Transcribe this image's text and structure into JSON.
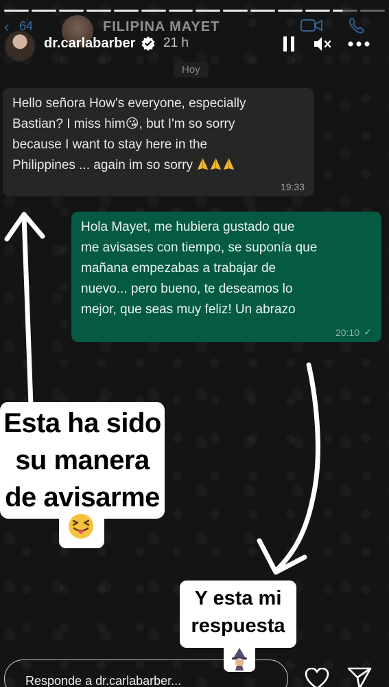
{
  "whatsapp_header": {
    "back_count": "64",
    "contact_name": "FILIPINA MAYET"
  },
  "story_header": {
    "username": "dr.carlabarber",
    "time_ago": "21 h"
  },
  "chat": {
    "day_label": "Hoy",
    "incoming": {
      "line1": "Hello señora How's everyone, especially",
      "line2_a": "Bastian?  I miss him",
      "line2_b": ", but I'm so sorry",
      "line3": "because I want to stay here in the",
      "line4": "Philippines ... again im so sorry",
      "time": "19:33"
    },
    "outgoing": {
      "line1": "Hola Mayet, me hubiera gustado que",
      "line2": "me avisases con tiempo, se suponía que",
      "line3": "mañana empezabas a trabajar de",
      "line4": "nuevo... pero bueno, te deseamos lo",
      "line5": "mejor, que seas muy feliz! Un abrazo",
      "time": "20:10",
      "check": "✓"
    }
  },
  "stickers": {
    "left": {
      "line1": "Esta ha sido",
      "line2": "su manera",
      "line3": "de avisarme"
    },
    "right": {
      "line1": "Y esta mi",
      "line2": "respuesta"
    }
  },
  "reply": {
    "placeholder": "Responde a dr.carlabarber..."
  },
  "colors": {
    "incoming_bubble": "#262626",
    "outgoing_bubble": "#055a43",
    "background": "#141414",
    "whatsapp_blue": "#3b82c4"
  },
  "icons": {
    "verified": "verified-badge-icon",
    "pause": "pause-icon",
    "mute": "mute-icon",
    "more": "more-icon",
    "heart": "heart-icon",
    "send": "send-icon"
  }
}
